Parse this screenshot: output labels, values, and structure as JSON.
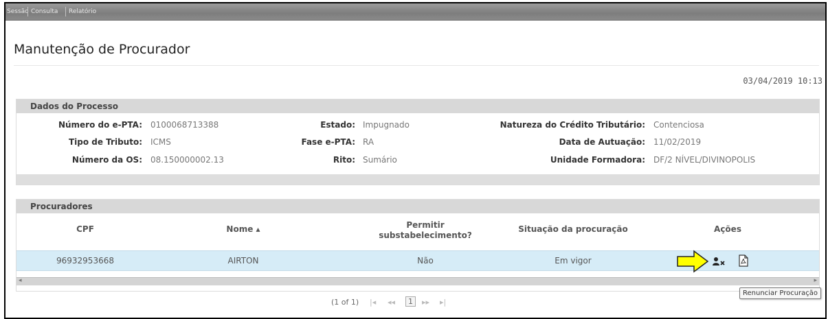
{
  "menu": {
    "items": [
      "Sessão",
      "Consulta",
      "Relatório"
    ]
  },
  "page": {
    "title": "Manutenção de Procurador",
    "datetime": "03/04/2019 10:13"
  },
  "dados_processo": {
    "header": "Dados do Processo",
    "fields": [
      {
        "label": "Número do e-PTA:",
        "value": "0100068713388"
      },
      {
        "label": "Estado:",
        "value": "Impugnado"
      },
      {
        "label": "Natureza do Crédito Tributário:",
        "value": "Contenciosa"
      },
      {
        "label": "Tipo de Tributo:",
        "value": "ICMS"
      },
      {
        "label": "Fase e-PTA:",
        "value": "RA"
      },
      {
        "label": "Data de Autuação:",
        "value": "11/02/2019"
      },
      {
        "label": "Número da OS:",
        "value": "08.150000002.13"
      },
      {
        "label": "Rito:",
        "value": "Sumário"
      },
      {
        "label": "Unidade Formadora:",
        "value": "DF/2 NÍVEL/DIVINOPOLIS"
      }
    ]
  },
  "procuradores": {
    "header": "Procuradores",
    "columns": {
      "cpf": "CPF",
      "nome": "Nome ▴",
      "permitir_1": "Permitir",
      "permitir_2": "substabelecimento?",
      "situacao": "Situação da procuração",
      "acoes": "Ações"
    },
    "rows": [
      {
        "cpf": "96932953668",
        "nome": "AIRTON",
        "permitir": "Não",
        "situacao": "Em vigor"
      }
    ]
  },
  "paginator": {
    "status": "(1 of 1)",
    "first": "|◂",
    "prev": "◂◂",
    "page": "1",
    "next": "▸▸",
    "last": "▸|"
  },
  "tooltip": {
    "text": "Renunciar Procuração"
  },
  "colors": {
    "row_selected": "#d6ecf7",
    "arrow_fill": "#ffff00",
    "panel_header": "#d8d8d8"
  }
}
